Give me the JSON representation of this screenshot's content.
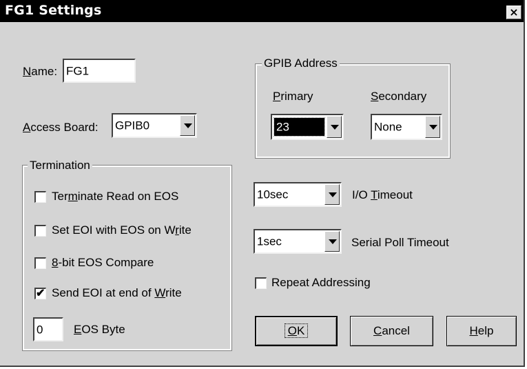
{
  "window": {
    "title": "FG1 Settings",
    "close_glyph": "×"
  },
  "name_field": {
    "label_ul": "N",
    "label_rest": "ame:",
    "value": "FG1"
  },
  "access_board": {
    "label_ul": "A",
    "label_rest": "ccess Board:",
    "value": "GPIB0"
  },
  "termination": {
    "title": "Termination",
    "items": [
      {
        "pre": "Ter",
        "ul": "m",
        "post": "inate Read on EOS",
        "checked": false
      },
      {
        "pre": "Set EOI with EOS on W",
        "ul": "r",
        "post": "ite",
        "checked": false
      },
      {
        "pre": "",
        "ul": "8",
        "post": "-bit EOS Compare",
        "checked": false
      },
      {
        "pre": "Send EOI at end of ",
        "ul": "W",
        "post": "rite",
        "checked": true
      }
    ],
    "eos_byte": {
      "value": "0",
      "label_ul": "E",
      "label_rest": "OS Byte"
    },
    "check_glyph": "✔"
  },
  "gpib_address": {
    "title": "GPIB Address",
    "primary": {
      "label_ul": "P",
      "label_rest": "rimary",
      "value": "23"
    },
    "secondary": {
      "label_ul": "S",
      "label_rest": "econdary",
      "value": "None"
    }
  },
  "io_timeout": {
    "value": "10sec",
    "label_pre": "I/O ",
    "label_ul": "T",
    "label_rest": "imeout"
  },
  "serial_poll": {
    "value": "1sec",
    "label": "Serial Poll Timeout"
  },
  "repeat_addressing": {
    "label": "Repeat Addressing",
    "checked": false
  },
  "buttons": {
    "ok": {
      "ul": "O",
      "rest": "K"
    },
    "cancel": {
      "ul": "C",
      "rest": "ancel"
    },
    "help": {
      "ul": "H",
      "rest": "elp"
    }
  }
}
